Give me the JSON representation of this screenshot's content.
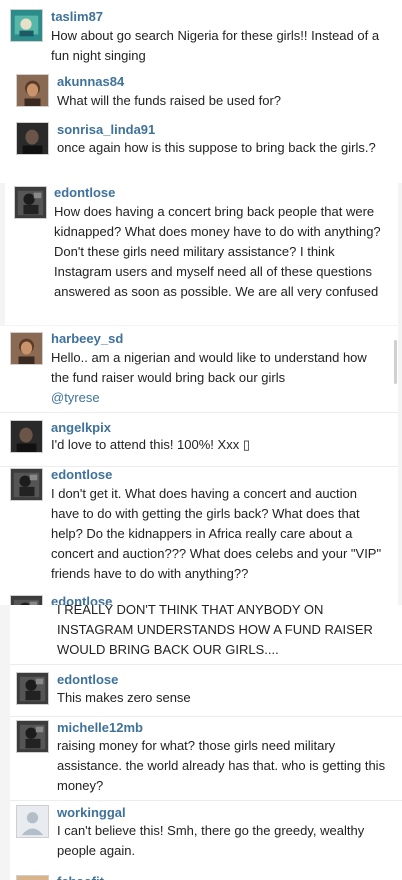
{
  "screen_a": {
    "comments": [
      {
        "username": "taslim87",
        "text": "How about go search Nigeria for these girls!! Instead of a fun night singing",
        "avatar": "avatar-teal-icon"
      },
      {
        "username": "akunnas84",
        "text": "What will the funds raised be used for?",
        "avatar": "avatar-woman-icon"
      },
      {
        "username": "sonrisa_linda91",
        "text": "once again how is this suppose to bring back the girls.?",
        "avatar": "avatar-dark-icon"
      }
    ]
  },
  "screen_b": {
    "comments": [
      {
        "username": "edontlose",
        "text": "How does having a concert bring back people that were kidnapped? What does money have to do with anything? Don't these girls need military assistance? I think Instagram users and myself need all of these questions answered as soon as possible. We are all very confused",
        "avatar": "avatar-man-icon"
      }
    ]
  },
  "screen_c": {
    "comments": [
      {
        "username": "harbeey_sd",
        "text": "Hello.. am a nigerian and would like to understand how the fund raiser would bring back our girls",
        "mention": "@tyrese",
        "avatar": "avatar-woman-icon"
      },
      {
        "username": "angelkpix",
        "text": "I'd love to attend this! 100%! Xxx ▯",
        "avatar": "avatar-woman-icon"
      },
      {
        "username": "edontlose",
        "text": "I don't get it. What does having a concert and auction have to do with getting the girls back? What does that help? Do the kidnappers in Africa really care about a concert and auction??? What does celebs and your \"VIP\" friends have to do with anything??",
        "avatar": "avatar-man-icon"
      },
      {
        "username": "edontlose",
        "avatar": "avatar-man-icon"
      }
    ]
  },
  "screen_d": {
    "partial_text": "I REALLY DON'T THINK THAT ANYBODY ON INSTAGRAM UNDERSTANDS HOW A FUND RAISER WOULD BRING BACK OUR GIRLS....",
    "comments": [
      {
        "username": "edontlose",
        "text": "This makes zero sense",
        "avatar": "avatar-man-icon"
      },
      {
        "username": "michelle12mb",
        "text": "raising money for what? those girls need military assistance. the world already has that. who is getting this money?",
        "avatar": "avatar-dark-icon"
      },
      {
        "username": "workinggal",
        "text": "I can't believe this! Smh, there go the greedy, wealthy people again.",
        "avatar": "default-avatar-icon"
      },
      {
        "username": "fchaofit",
        "avatar": "avatar-woman-icon"
      }
    ]
  },
  "colors": {
    "username": "#3f729b",
    "text": "#222222",
    "separator": "#ededed",
    "background": "#ffffff"
  }
}
